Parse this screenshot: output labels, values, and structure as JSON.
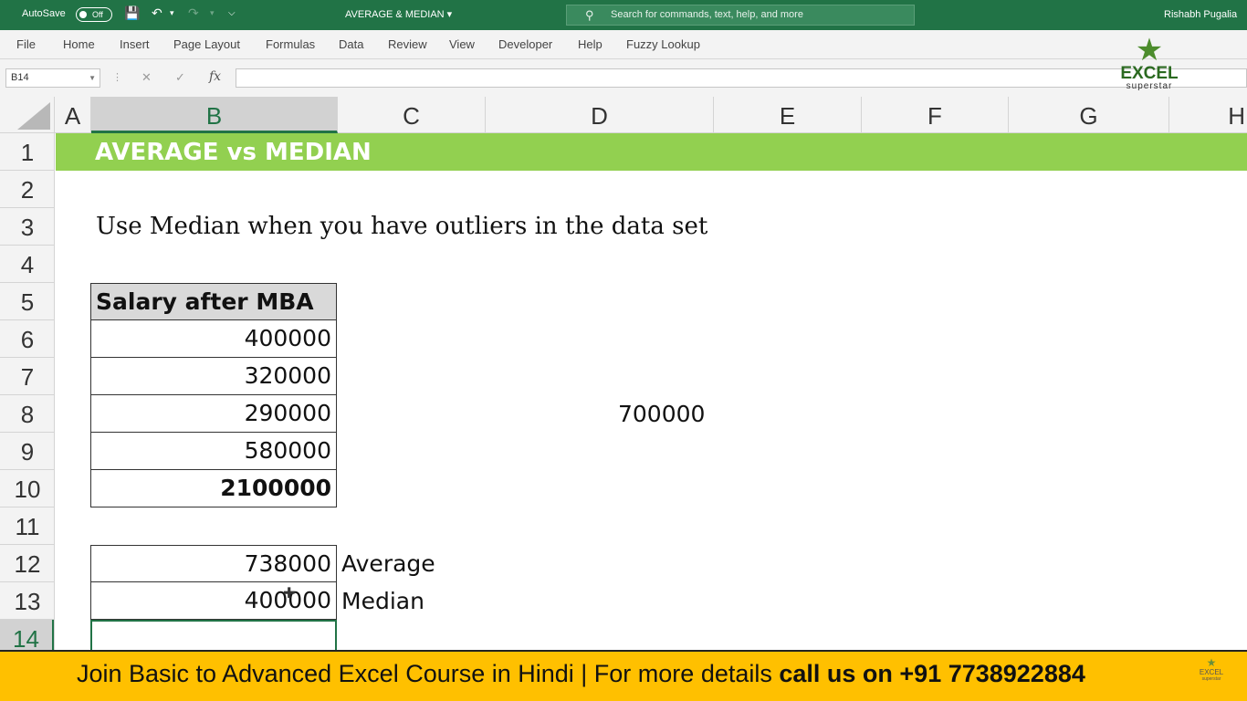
{
  "titlebar": {
    "autosave_label": "AutoSave",
    "autosave_state": "Off",
    "document_title": "AVERAGE & MEDIAN",
    "search_placeholder": "Search for commands, text, help, and more",
    "user_name": "Rishabh Pugalia"
  },
  "ribbon": {
    "tabs": [
      "File",
      "Home",
      "Insert",
      "Page Layout",
      "Formulas",
      "Data",
      "Review",
      "View",
      "Developer",
      "Help",
      "Fuzzy Lookup"
    ]
  },
  "formula_bar": {
    "name_box": "B14",
    "fx_label": "fx",
    "formula": ""
  },
  "logo": {
    "line1": "EXCEL",
    "line2": "superstar"
  },
  "sheet": {
    "columns": [
      "A",
      "B",
      "C",
      "D",
      "E",
      "F",
      "G",
      "H"
    ],
    "active_column": "B",
    "rows": [
      "1",
      "2",
      "3",
      "4",
      "5",
      "6",
      "7",
      "8",
      "9",
      "10",
      "11",
      "12",
      "13",
      "14"
    ],
    "active_row": "14",
    "banner_title": "AVERAGE vs MEDIAN",
    "note": "Use Median when you have outliers in the data set",
    "table_header": "Salary after MBA",
    "salaries": [
      "400000",
      "320000",
      "290000",
      "580000"
    ],
    "total": "2100000",
    "d8_value": "700000",
    "average_value": "738000",
    "average_label": "Average",
    "median_value": "400000",
    "median_label": "Median",
    "selected_cell": "B14"
  },
  "footer": {
    "text_regular": "Join Basic to Advanced Excel Course in Hindi | For more details ",
    "text_bold": "call us on +91 7738922884",
    "badge_line1": "EXCEL",
    "badge_line2": "superstar"
  },
  "colors": {
    "excel_green": "#217346",
    "banner_green": "#92d050",
    "footer_yellow": "#ffc000",
    "header_gray": "#d9d9d9"
  }
}
